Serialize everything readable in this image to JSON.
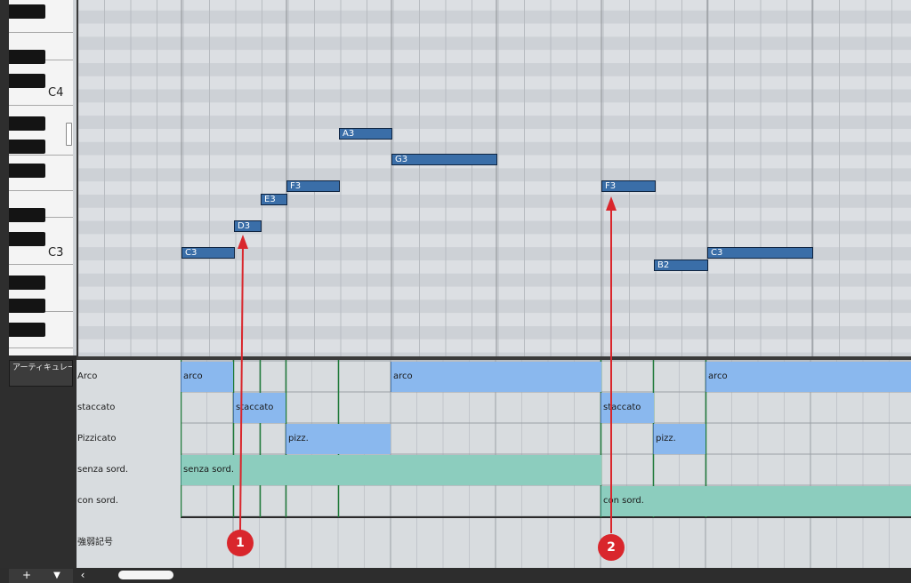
{
  "piano_roll": {
    "key_labels": {
      "c4": "C4",
      "c3": "C3"
    },
    "notes": [
      {
        "pitch": "C3"
      },
      {
        "pitch": "D3"
      },
      {
        "pitch": "E3"
      },
      {
        "pitch": "F3"
      },
      {
        "pitch": "A3"
      },
      {
        "pitch": "G3"
      },
      {
        "pitch": "F3"
      },
      {
        "pitch": "B2"
      },
      {
        "pitch": "C3"
      }
    ]
  },
  "articulation_panel": {
    "header": "アーティキュレーション",
    "lanes": {
      "arco": "Arco",
      "staccato": "staccato",
      "pizzicato": "Pizzicato",
      "senza_sord": "senza sord.",
      "con_sord": "con sord.",
      "dynamics": "強弱記号"
    },
    "blocks": [
      {
        "label": "arco"
      },
      {
        "label": "arco"
      },
      {
        "label": "arco"
      },
      {
        "label": "staccato"
      },
      {
        "label": "staccato"
      },
      {
        "label": "pizz."
      },
      {
        "label": "pizz."
      },
      {
        "label": "senza sord."
      },
      {
        "label": "con sord."
      }
    ]
  },
  "bottom_toolbar": {
    "add": "+",
    "menu": "▼",
    "scroll_left": "‹"
  },
  "annotations": [
    {
      "label": "1"
    },
    {
      "label": "2"
    }
  ],
  "colors": {
    "note_fill": "#3a6ea8",
    "articulation_blue": "#8ab8ee",
    "articulation_teal": "#8ccdbe",
    "marker_red": "#d9262c"
  }
}
